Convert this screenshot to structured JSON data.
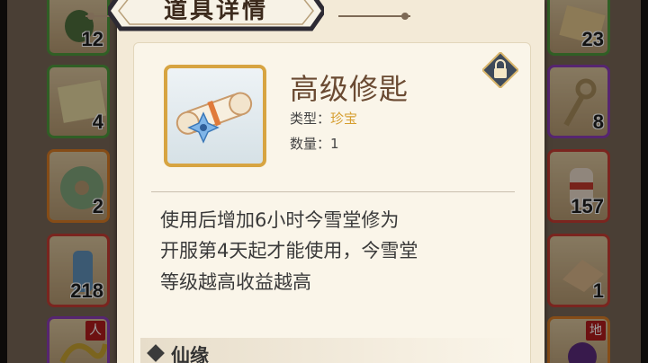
{
  "dialog": {
    "title": "道具详情",
    "item": {
      "name": "高级修匙",
      "type_label": "类型：",
      "type_value": "珍宝",
      "quantity_label": "数量：",
      "quantity_value": "1",
      "description_lines": [
        "使用后增加6小时今雪堂修为",
        "开服第4天起才能使用，今雪堂",
        "等级越高收益越高"
      ]
    },
    "section_label": "仙缘"
  },
  "inventory_left": [
    {
      "count": "12",
      "rarity": "green"
    },
    {
      "count": "4",
      "rarity": "green"
    },
    {
      "count": "2",
      "rarity": "orange"
    },
    {
      "count": "218",
      "rarity": "red"
    },
    {
      "count": "",
      "tag": "人",
      "rarity": "purple"
    }
  ],
  "inventory_right": [
    {
      "count": "23",
      "rarity": "green"
    },
    {
      "count": "8",
      "rarity": "purple"
    },
    {
      "count": "157",
      "rarity": "red"
    },
    {
      "count": "1",
      "rarity": "red"
    },
    {
      "count": "",
      "tag": "地",
      "rarity": "orange"
    }
  ],
  "colors": {
    "panel_bg": "#f3ead7",
    "item_name": "#6a4a32",
    "type_value": "#d69e2f",
    "frame_gold": "#d7a441"
  },
  "icons": [
    "lock-icon",
    "scroll-icon"
  ]
}
